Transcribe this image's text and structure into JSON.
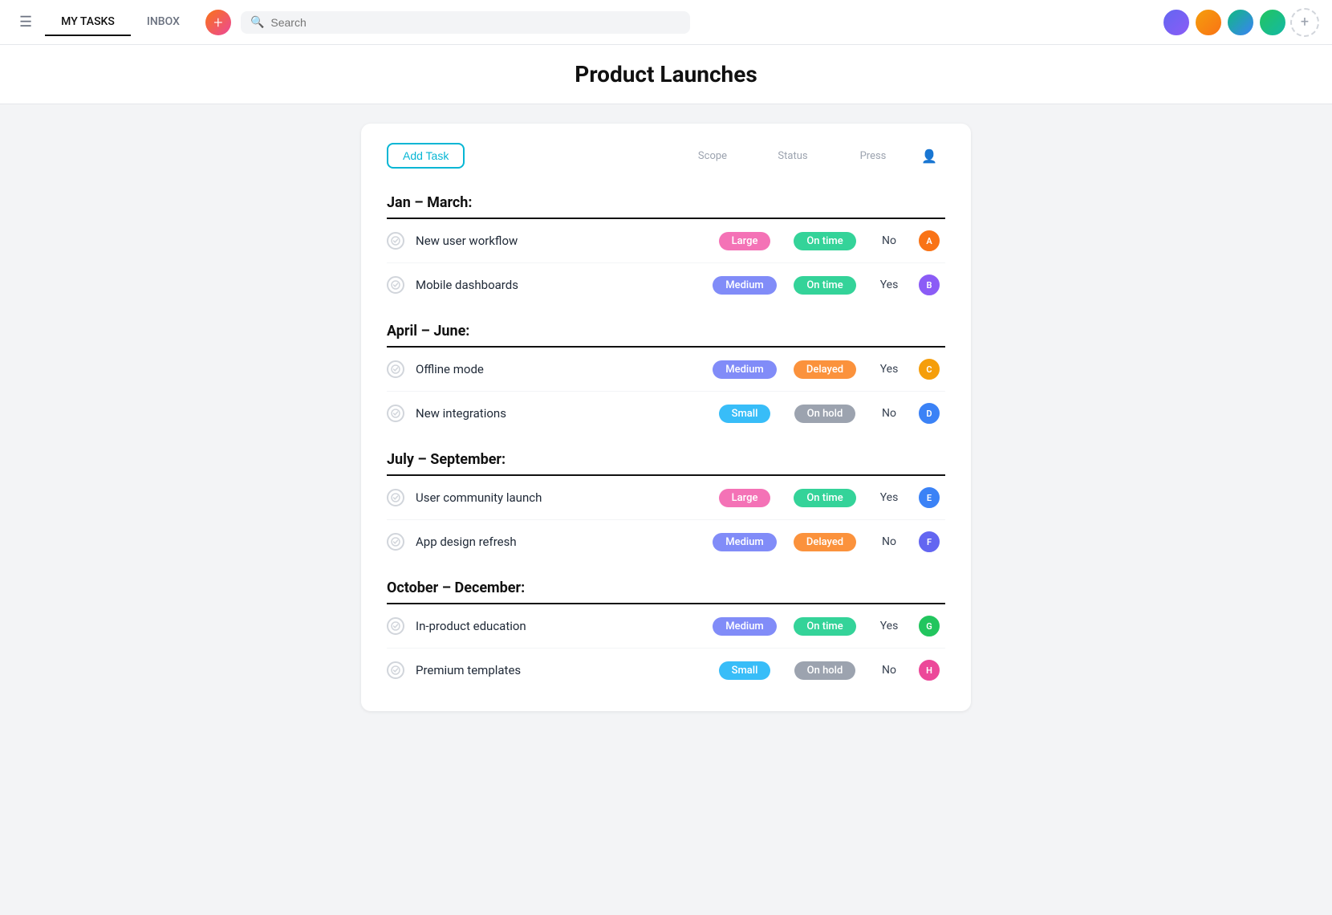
{
  "nav": {
    "hamburger_label": "☰",
    "my_tasks_label": "MY TASKS",
    "inbox_label": "INBOX",
    "search_placeholder": "Search",
    "add_icon": "+",
    "add_member_icon": "+"
  },
  "page": {
    "title": "Product Launches"
  },
  "card": {
    "add_task_label": "Add Task",
    "columns": {
      "scope": "Scope",
      "status": "Status",
      "press": "Press"
    }
  },
  "sections": [
    {
      "title": "Jan – March:",
      "tasks": [
        {
          "name": "New user workflow",
          "scope": "Large",
          "scope_class": "badge-large",
          "status": "On time",
          "status_class": "badge-ontime",
          "press": "No",
          "avatar_class": "av-orange",
          "avatar_initials": "A"
        },
        {
          "name": "Mobile dashboards",
          "scope": "Medium",
          "scope_class": "badge-medium",
          "status": "On time",
          "status_class": "badge-ontime",
          "press": "Yes",
          "avatar_class": "av-purple",
          "avatar_initials": "B"
        }
      ]
    },
    {
      "title": "April – June:",
      "tasks": [
        {
          "name": "Offline mode",
          "scope": "Medium",
          "scope_class": "badge-medium",
          "status": "Delayed",
          "status_class": "badge-delayed",
          "press": "Yes",
          "avatar_class": "av-amber",
          "avatar_initials": "C"
        },
        {
          "name": "New integrations",
          "scope": "Small",
          "scope_class": "badge-small",
          "status": "On hold",
          "status_class": "badge-onhold",
          "press": "No",
          "avatar_class": "av-blue",
          "avatar_initials": "D"
        }
      ]
    },
    {
      "title": "July – September:",
      "tasks": [
        {
          "name": "User community launch",
          "scope": "Large",
          "scope_class": "badge-large",
          "status": "On time",
          "status_class": "badge-ontime",
          "press": "Yes",
          "avatar_class": "av-blue",
          "avatar_initials": "E"
        },
        {
          "name": "App design refresh",
          "scope": "Medium",
          "scope_class": "badge-medium",
          "status": "Delayed",
          "status_class": "badge-delayed",
          "press": "No",
          "avatar_class": "av-indigo",
          "avatar_initials": "F"
        }
      ]
    },
    {
      "title": "October – December:",
      "tasks": [
        {
          "name": "In-product education",
          "scope": "Medium",
          "scope_class": "badge-medium",
          "status": "On time",
          "status_class": "badge-ontime",
          "press": "Yes",
          "avatar_class": "av-green",
          "avatar_initials": "G"
        },
        {
          "name": "Premium templates",
          "scope": "Small",
          "scope_class": "badge-small",
          "status": "On hold",
          "status_class": "badge-onhold",
          "press": "No",
          "avatar_class": "av-pink",
          "avatar_initials": "H"
        }
      ]
    }
  ]
}
